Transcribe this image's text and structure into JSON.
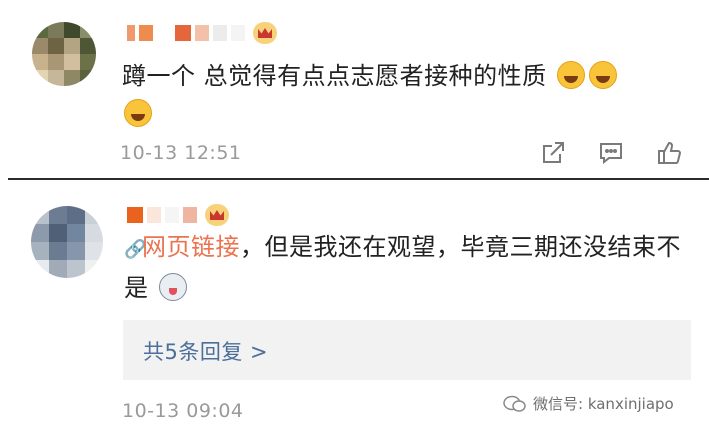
{
  "comments": [
    {
      "text": "蹲一个 总觉得有点点志愿者接种的性质",
      "time": "10-13 12:51",
      "emoji_icon": "laugh-cry-emoji"
    },
    {
      "link_label": "网页链接",
      "text": "，但是我还在观望，毕竟三期还没结束不是",
      "time": "10-13 09:04",
      "replies_label": "共5条回复 >",
      "emoji_icon": "dog-emoji"
    }
  ],
  "watermark": {
    "text": "微信号: kanxinjiapo"
  },
  "colors": {
    "link": "#eb7350",
    "reply": "#4b6f9a",
    "muted": "#9a9a9a"
  }
}
